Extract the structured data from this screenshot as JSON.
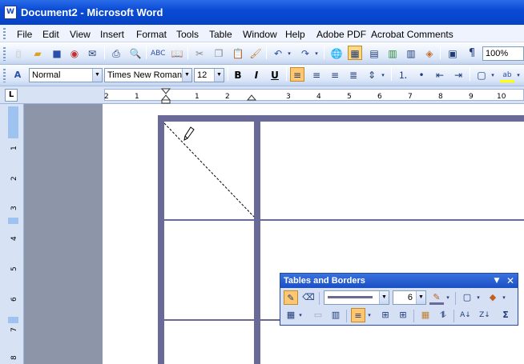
{
  "window": {
    "title": "Document2 - Microsoft Word",
    "icon_letter": "W"
  },
  "menu": [
    "File",
    "Edit",
    "View",
    "Insert",
    "Format",
    "Tools",
    "Table",
    "Window",
    "Help",
    "Adobe PDF",
    "Acrobat Comments"
  ],
  "standard_toolbar": {
    "zoom": "100%"
  },
  "formatting_toolbar": {
    "style": "Normal",
    "font": "Times New Roman",
    "size": "12"
  },
  "ruler": {
    "numbers": [
      "2",
      "1",
      "1",
      "2",
      "3",
      "4",
      "5",
      "6",
      "7",
      "8",
      "9",
      "10",
      "11"
    ]
  },
  "vruler": {
    "numbers": [
      "1",
      "2",
      "3",
      "4",
      "5",
      "6",
      "7",
      "8"
    ]
  },
  "tables_and_borders": {
    "title": "Tables and Borders",
    "line_weight": "6"
  },
  "colors": {
    "title_bar": "#0a4bd6",
    "table_border": "#6a6a99",
    "toolbar_bg": "#d9e5f8"
  }
}
